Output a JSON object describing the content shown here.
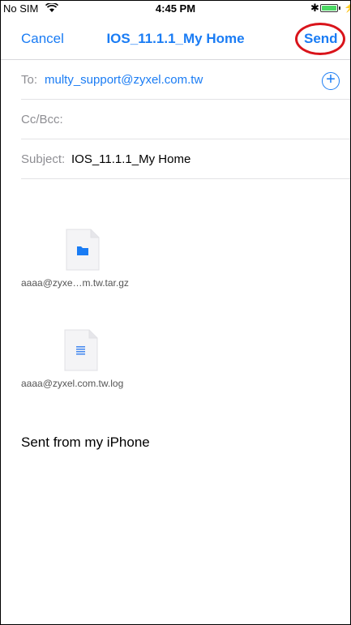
{
  "status_bar": {
    "carrier": "No SIM",
    "time": "4:45 PM",
    "bluetooth_symbol": "✱",
    "charging_symbol": "⚡"
  },
  "nav": {
    "cancel_label": "Cancel",
    "title": "IOS_11.1.1_My Home",
    "send_label": "Send"
  },
  "fields": {
    "to_label": "To:",
    "to_value": "multy_support@zyxel.com.tw",
    "cc_label": "Cc/Bcc:",
    "subject_label": "Subject:",
    "subject_value": "IOS_11.1.1_My Home"
  },
  "attachments": [
    {
      "name": "aaaa@zyxe…m.tw.tar.gz",
      "icon": "folder-file-icon"
    },
    {
      "name": "aaaa@zyxel.com.tw.log",
      "icon": "text-file-icon"
    }
  ],
  "body": {
    "signature": "Sent from my iPhone"
  },
  "colors": {
    "accent": "#1a7cf4",
    "highlight_ring": "#d9141b",
    "battery": "#4cd964"
  }
}
